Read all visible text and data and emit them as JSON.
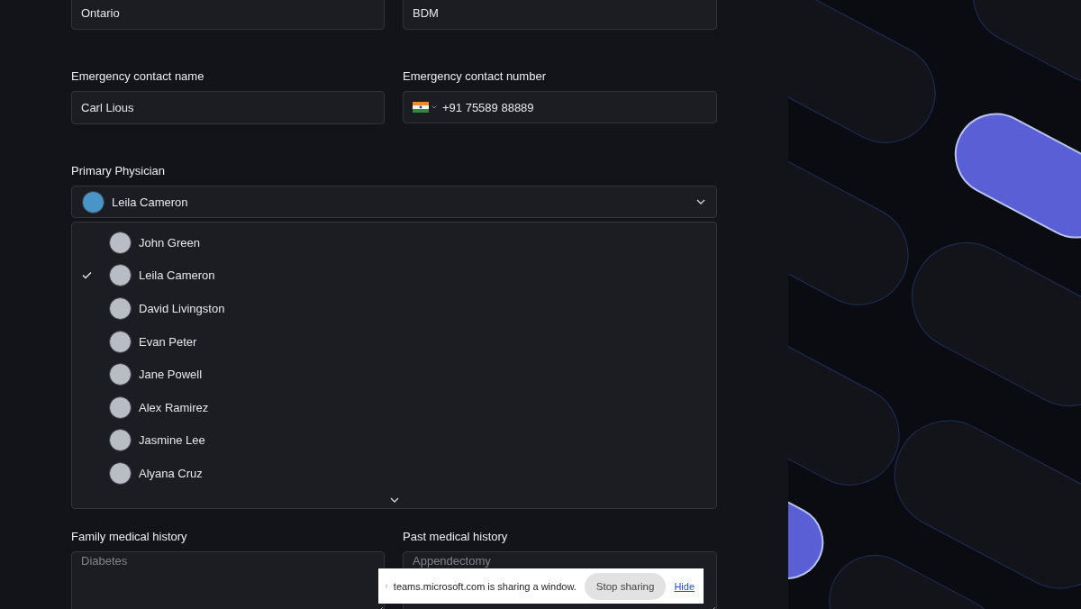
{
  "form": [
    {
      "kind": "row",
      "fields": [
        {
          "kind": "text",
          "value": "Ontario"
        },
        {
          "kind": "text",
          "value": "BDM"
        }
      ]
    },
    {
      "kind": "row",
      "fields": [
        {
          "kind": "text",
          "label": "Emergency contact name",
          "value": "Carl Lious"
        },
        {
          "kind": "phone",
          "label": "Emergency contact number",
          "value": "+91 75589 88889"
        }
      ]
    },
    {
      "kind": "select",
      "label": "Primary Physician",
      "value": "Leila Cameron",
      "open": true,
      "options": [
        {
          "name": "John Green",
          "selected": false
        },
        {
          "name": "Leila Cameron",
          "selected": true
        },
        {
          "name": "David Livingston",
          "selected": false
        },
        {
          "name": "Evan Peter",
          "selected": false
        },
        {
          "name": "Jane Powell",
          "selected": false
        },
        {
          "name": "Alex Ramirez",
          "selected": false
        },
        {
          "name": "Jasmine Lee",
          "selected": false
        },
        {
          "name": "Alyana Cruz",
          "selected": false
        }
      ]
    },
    {
      "kind": "row",
      "fields": [
        {
          "kind": "textarea",
          "label": "Family medical history",
          "placeholder": "Diabetes"
        },
        {
          "kind": "textarea",
          "label": "Past medical history",
          "placeholder": "Appendectomy"
        }
      ]
    }
  ],
  "sharing_bar": {
    "message": "teams.microsoft.com is sharing a window.",
    "stop_button": "Stop sharing",
    "hide_link": "Hide"
  }
}
